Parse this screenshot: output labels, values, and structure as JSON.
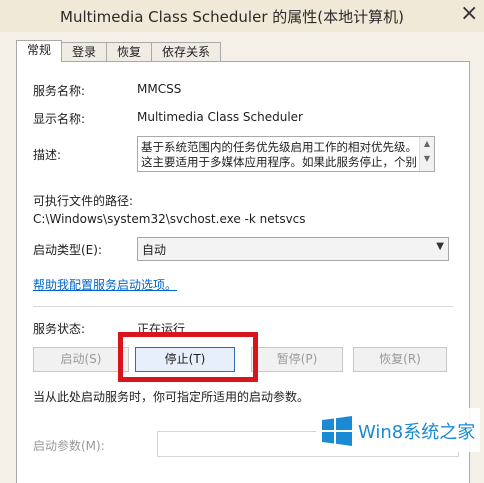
{
  "window": {
    "title": "Multimedia Class Scheduler 的属性(本地计算机)",
    "close_glyph": "×"
  },
  "tabs": [
    {
      "label": "常规",
      "active": true
    },
    {
      "label": "登录",
      "active": false
    },
    {
      "label": "恢复",
      "active": false
    },
    {
      "label": "依存关系",
      "active": false
    }
  ],
  "general": {
    "service_name_label": "服务名称:",
    "service_name_value": "MMCSS",
    "display_name_label": "显示名称:",
    "display_name_value": "Multimedia Class Scheduler",
    "description_label": "描述:",
    "description_value": "基于系统范围内的任务优先级启用工作的相对优先级。\n这主要适用于多媒体应用程序。如果此服务停止，个别",
    "exe_path_label": "可执行文件的路径:",
    "exe_path_value": "C:\\Windows\\system32\\svchost.exe -k netsvcs",
    "startup_type_label": "启动类型(E):",
    "startup_type_value": "自动",
    "help_link": "帮助我配置服务启动选项。",
    "status_label": "服务状态:",
    "status_value": "正在运行",
    "buttons": {
      "start": "启动(S)",
      "stop": "停止(T)",
      "pause": "暂停(P)",
      "resume": "恢复(R)"
    },
    "params_hint": "当从此处启动服务时，你可指定所适用的启动参数。",
    "start_params_label": "启动参数(M):",
    "start_params_value": ""
  },
  "watermark": {
    "text": "Win8系统之家"
  },
  "colors": {
    "highlight": "#d9141c",
    "link": "#0066cc",
    "watermark": "#1a8ad4"
  }
}
